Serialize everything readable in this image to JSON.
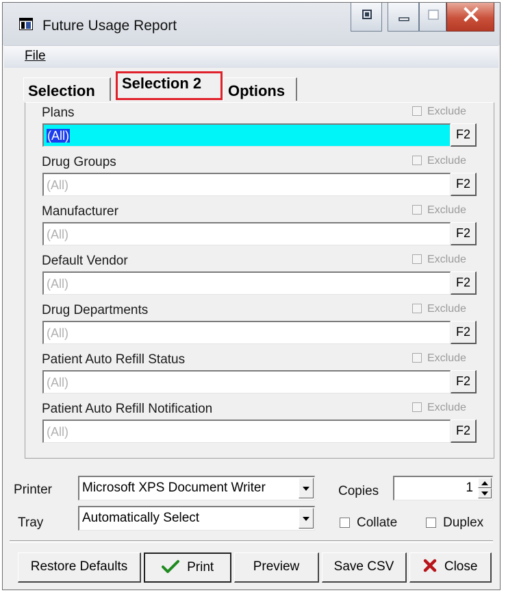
{
  "window": {
    "title": "Future Usage Report"
  },
  "menu": {
    "file_label": "File"
  },
  "tabs": [
    {
      "label": "Selection",
      "active": false
    },
    {
      "label": "Selection 2",
      "active": true
    },
    {
      "label": "Options",
      "active": false
    }
  ],
  "fields": [
    {
      "label": "Plans",
      "value": "(All)",
      "exclude_label": "Exclude",
      "button": "F2",
      "selected": true
    },
    {
      "label": "Drug Groups",
      "value": "(All)",
      "exclude_label": "Exclude",
      "button": "F2",
      "selected": false
    },
    {
      "label": "Manufacturer",
      "value": "(All)",
      "exclude_label": "Exclude",
      "button": "F2",
      "selected": false
    },
    {
      "label": "Default Vendor",
      "value": "(All)",
      "exclude_label": "Exclude",
      "button": "F2",
      "selected": false
    },
    {
      "label": "Drug Departments",
      "value": "(All)",
      "exclude_label": "Exclude",
      "button": "F2",
      "selected": false
    },
    {
      "label": "Patient Auto Refill Status",
      "value": "(All)",
      "exclude_label": "Exclude",
      "button": "F2",
      "selected": false
    },
    {
      "label": "Patient Auto Refill Notification",
      "value": "(All)",
      "exclude_label": "Exclude",
      "button": "F2",
      "selected": false
    }
  ],
  "print_settings": {
    "printer_label": "Printer",
    "printer_value": "Microsoft XPS Document Writer",
    "tray_label": "Tray",
    "tray_value": "Automatically Select",
    "copies_label": "Copies",
    "copies_value": "1",
    "collate_label": "Collate",
    "duplex_label": "Duplex"
  },
  "buttons": {
    "restore": "Restore Defaults",
    "print": "Print",
    "preview": "Preview",
    "save_csv": "Save CSV",
    "close": "Close"
  },
  "colors": {
    "selected_field": "#00f5f9",
    "tab_highlight": "#e0202a",
    "print_check": "#1f8a1f",
    "close_x": "#b8141a"
  }
}
